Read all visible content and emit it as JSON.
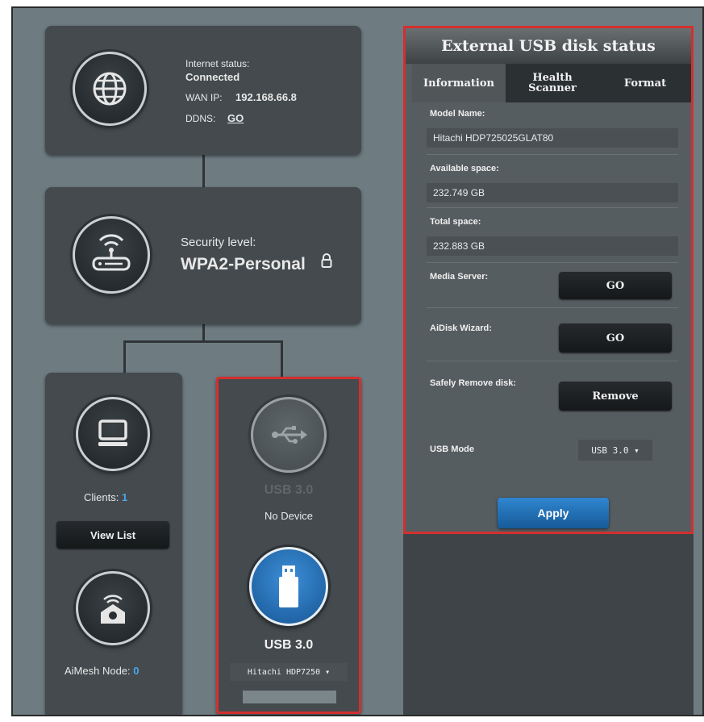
{
  "internet": {
    "status_label": "Internet status:",
    "status_value": "Connected",
    "wan_ip_label": "WAN IP:",
    "wan_ip_value": "192.168.66.8",
    "ddns_label": "DDNS:",
    "ddns_link": "GO"
  },
  "security": {
    "label": "Security level:",
    "value": "WPA2-Personal"
  },
  "clients": {
    "label": "Clients:",
    "count": "1",
    "view_list_button": "View List"
  },
  "aimesh": {
    "label": "AiMesh Node:",
    "count": "0"
  },
  "usb_slots": [
    {
      "label": "USB 3.0",
      "status": "No Device"
    },
    {
      "label": "USB 3.0",
      "selected_device": "Hitachi HDP7250 ▾"
    }
  ],
  "usb_panel": {
    "title": "External USB disk status",
    "tabs": [
      "Information",
      "Health Scanner",
      "Format"
    ],
    "model_name_label": "Model Name:",
    "model_name_value": "Hitachi HDP725025GLAT80",
    "available_space_label": "Available space:",
    "available_space_value": "232.749 GB",
    "total_space_label": "Total space:",
    "total_space_value": "232.883 GB",
    "media_server_label": "Media Server:",
    "media_server_button": "GO",
    "aidisk_label": "AiDisk Wizard:",
    "aidisk_button": "GO",
    "safely_remove_label": "Safely Remove disk:",
    "remove_button": "Remove",
    "usb_mode_label": "USB Mode",
    "usb_mode_value": "USB 3.0 ▾",
    "apply_button": "Apply"
  },
  "colors": {
    "highlight_border": "#d32f2f",
    "count_blue": "#4aa8e8",
    "apply_blue": "#1e6fb8"
  }
}
